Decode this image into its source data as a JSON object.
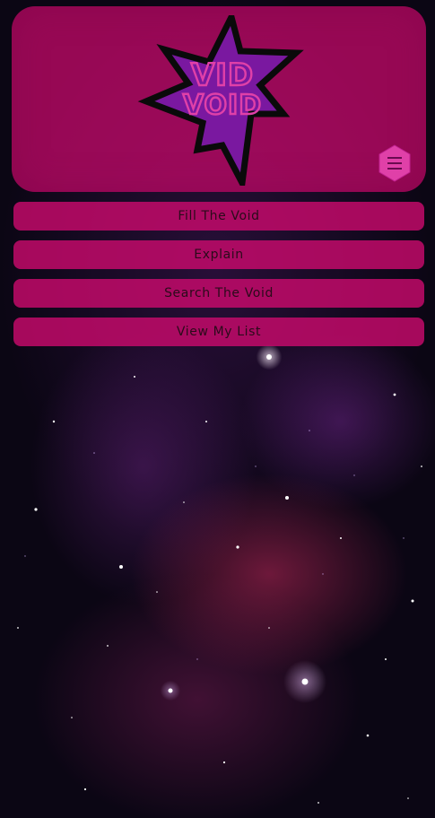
{
  "logo": {
    "line1": "VID",
    "line2": "VOID",
    "icon": "starburst-logo"
  },
  "menu": {
    "icon": "hamburger-menu-icon"
  },
  "nav": {
    "items": [
      {
        "label": "Fill The Void"
      },
      {
        "label": "Explain"
      },
      {
        "label": "Search The Void"
      },
      {
        "label": "View My List"
      }
    ]
  },
  "colors": {
    "panel": "#cd0a6e",
    "accent": "#e040a8",
    "logo_purple": "#7a18a0",
    "text_dark": "#2a0b1a"
  }
}
